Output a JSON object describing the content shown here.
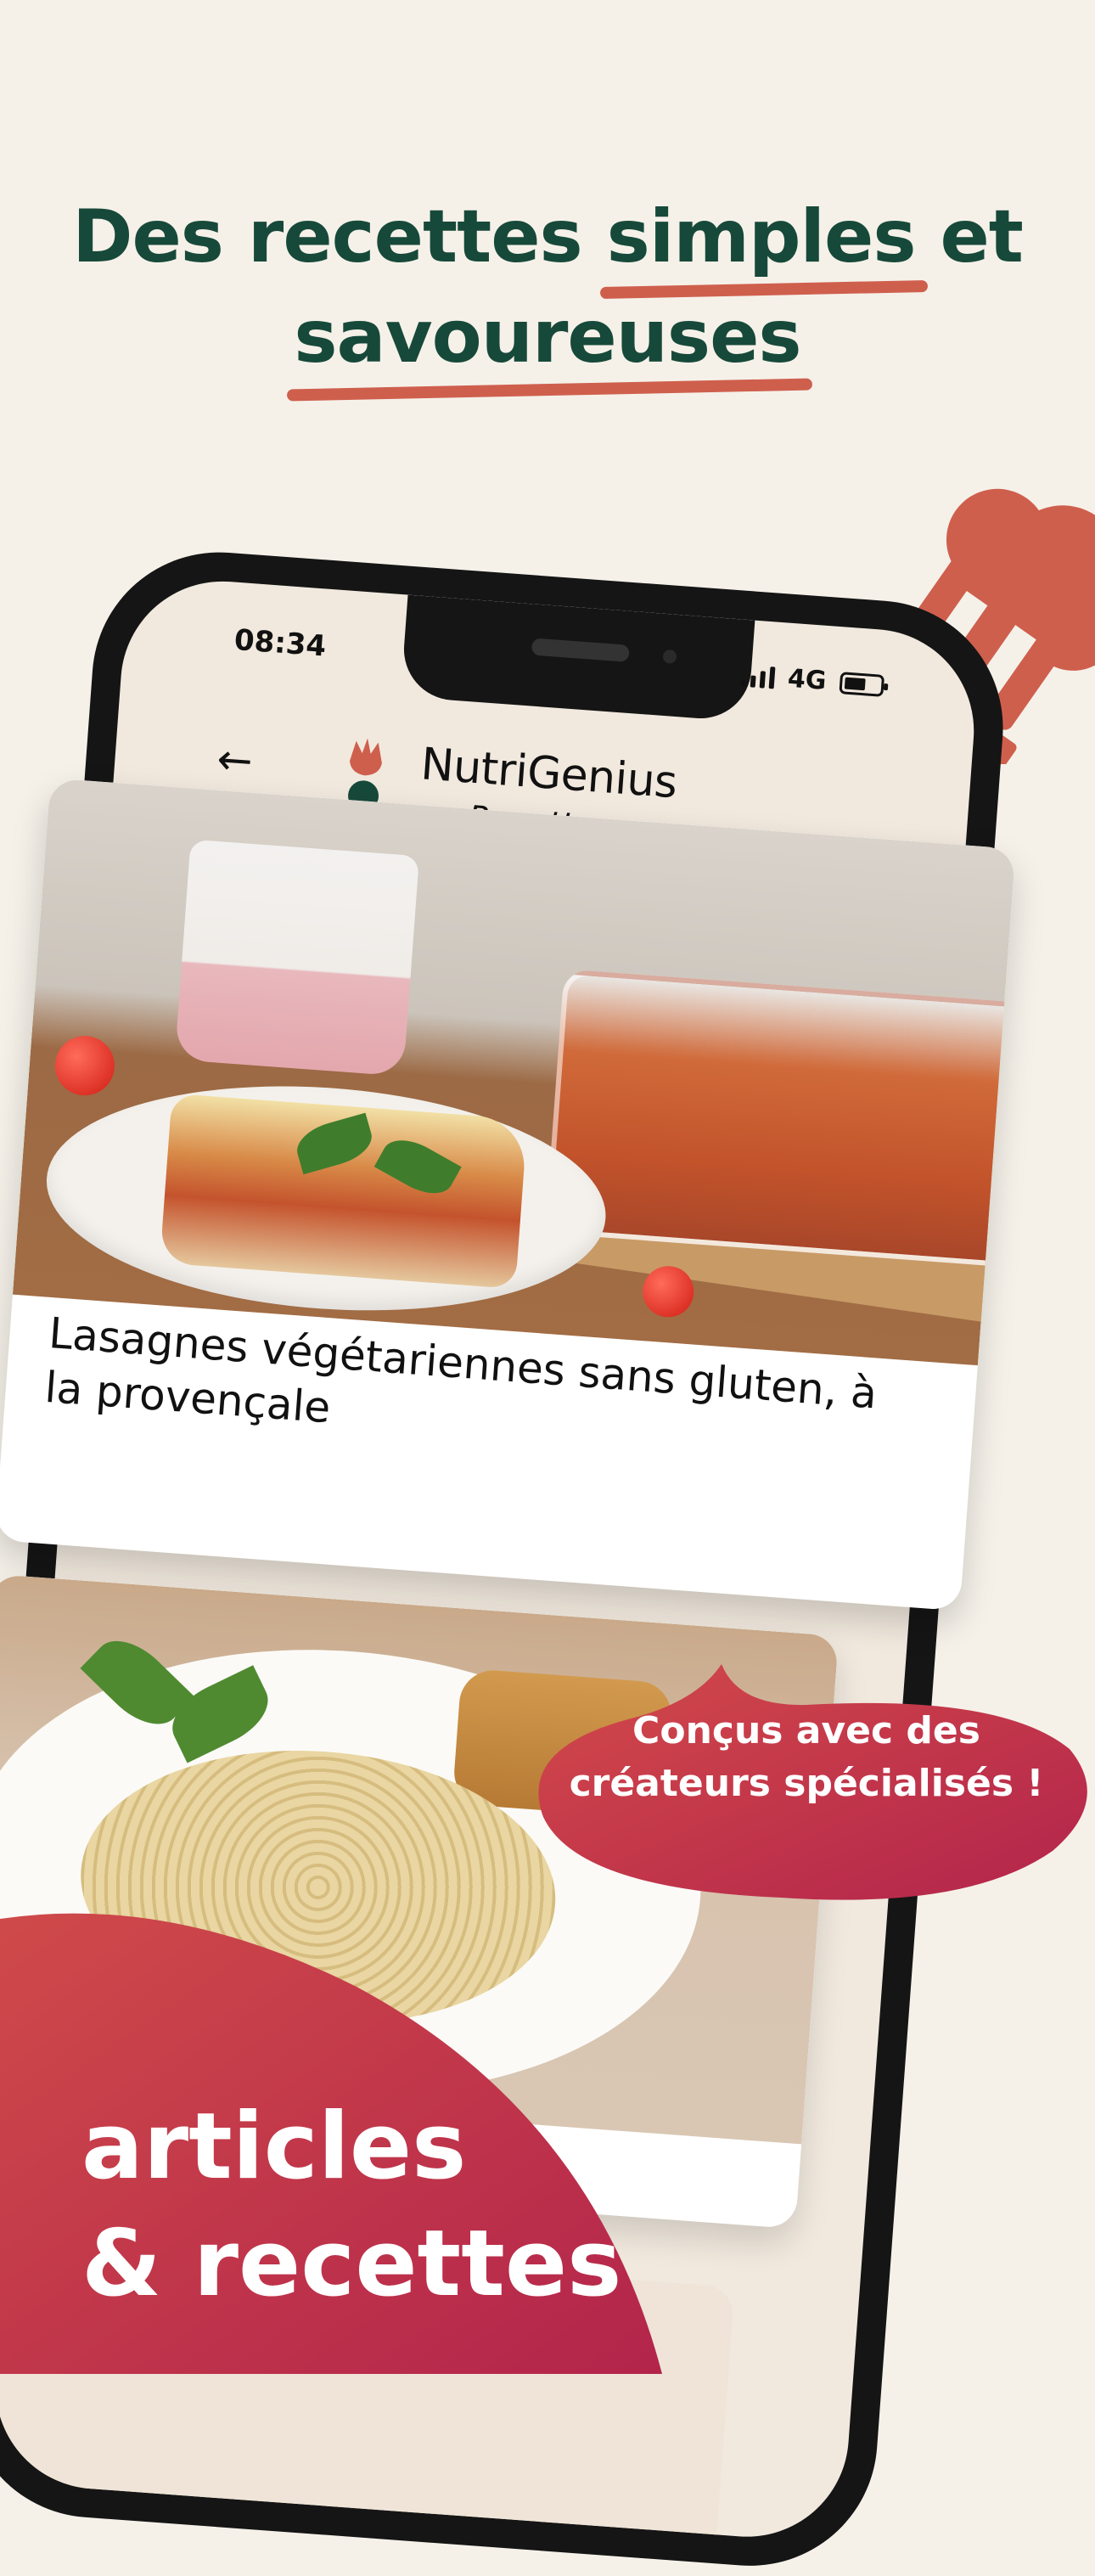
{
  "headline": {
    "line1_prefix": "Des recettes ",
    "line1_highlight": "simples",
    "line1_suffix": " et",
    "line2_highlight": "savoureuses"
  },
  "status_bar": {
    "time": "08:34",
    "network": "4G"
  },
  "app_bar": {
    "back_icon": "arrow-left-icon",
    "title": "NutriGenius",
    "subtitle": "Recette"
  },
  "cards": [
    {
      "caption": "Lasagnes végétariennes sans gluten, à la provençale"
    }
  ],
  "bubble": {
    "line1": "Conçus avec des",
    "line2": "créateurs spécialisés !"
  },
  "bottom_banner": {
    "line1": "articles",
    "line2": "& recettes"
  },
  "colors": {
    "background": "#f5f1e9",
    "headline": "#17493a",
    "accent": "#cf5f4d",
    "gradient_start": "#d34a4a",
    "gradient_end": "#b3244b"
  }
}
